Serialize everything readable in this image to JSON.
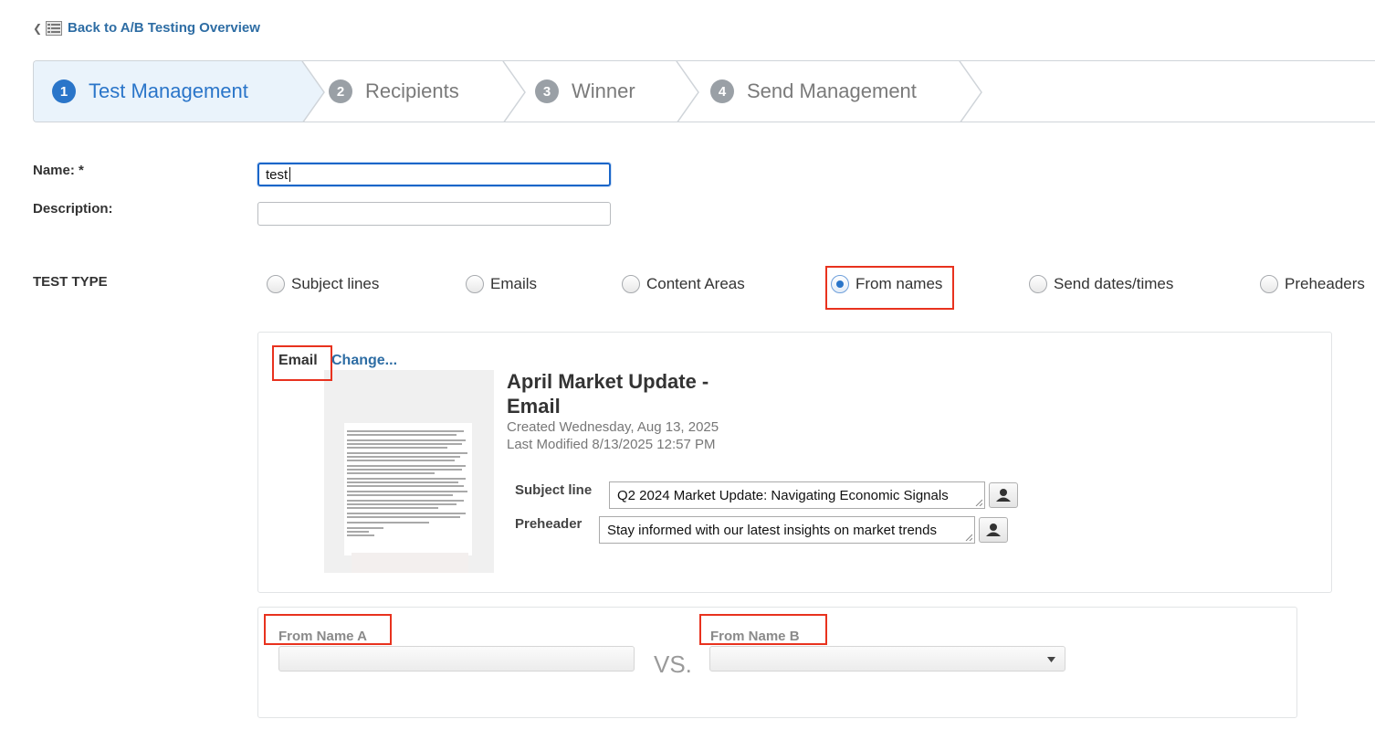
{
  "nav": {
    "back_label": "Back to A/B Testing Overview"
  },
  "wizard": {
    "steps": [
      {
        "num": "1",
        "label": "Test Management",
        "active": true
      },
      {
        "num": "2",
        "label": "Recipients",
        "active": false
      },
      {
        "num": "3",
        "label": "Winner",
        "active": false
      },
      {
        "num": "4",
        "label": "Send Management",
        "active": false
      }
    ]
  },
  "form": {
    "name_label": "Name: *",
    "name_value": "test",
    "description_label": "Description:",
    "description_value": "",
    "test_type_label": "TEST TYPE",
    "test_types": [
      {
        "label": "Subject lines",
        "checked": false
      },
      {
        "label": "Emails",
        "checked": false
      },
      {
        "label": "Content Areas",
        "checked": false
      },
      {
        "label": "From names",
        "checked": true
      },
      {
        "label": "Send dates/times",
        "checked": false
      },
      {
        "label": "Preheaders",
        "checked": false
      }
    ]
  },
  "email": {
    "section_label": "Email",
    "change_label": "Change...",
    "title_line1": "April Market Update -",
    "title_line2": "Email",
    "created": "Created Wednesday, Aug 13, 2025",
    "modified": "Last Modified 8/13/2025 12:57 PM",
    "subject_label": "Subject line",
    "subject_value": "Q2 2024 Market Update: Navigating Economic Signals",
    "preheader_label": "Preheader",
    "preheader_value": "Stay informed with our latest insights on market trends"
  },
  "from_names": {
    "a_label": "From Name A",
    "b_label": "From Name B",
    "vs_label": "VS.",
    "a_value": "",
    "b_value": ""
  },
  "colors": {
    "accent": "#2a75c9",
    "link": "#2e6da4",
    "highlight": "#e8321e"
  }
}
